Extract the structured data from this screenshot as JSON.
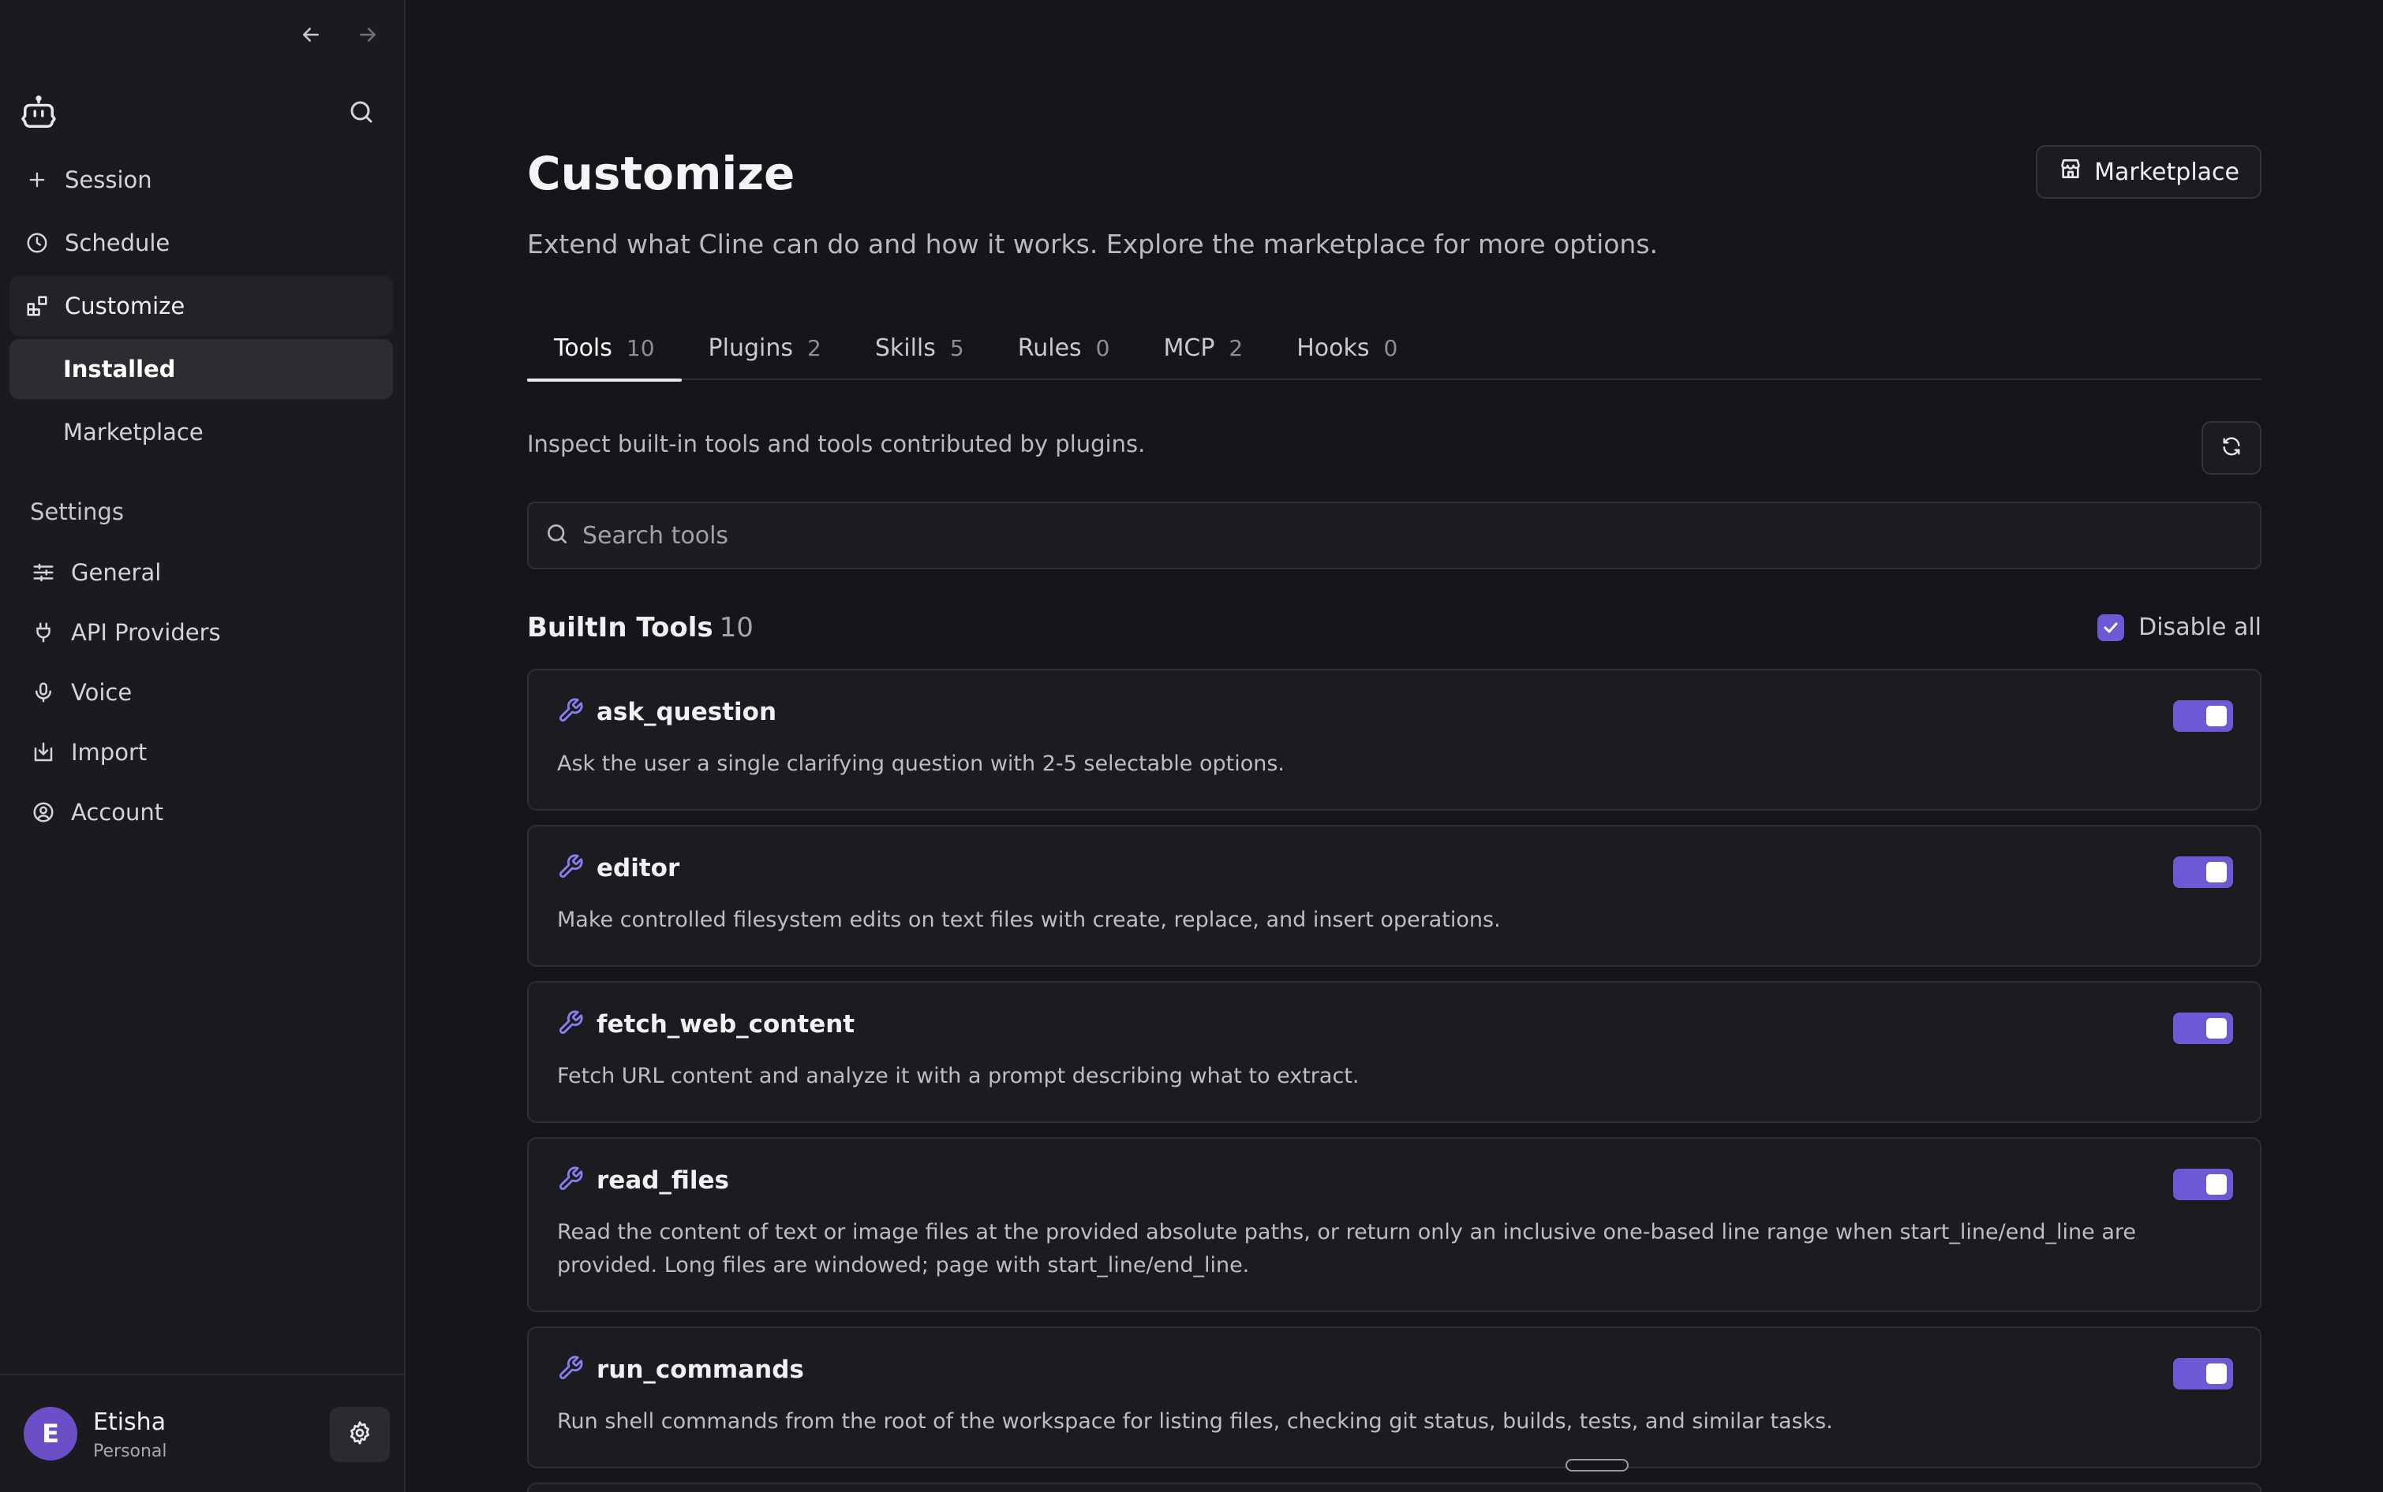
{
  "sidebar": {
    "nav": [
      {
        "label": "Session",
        "icon": "plus-icon"
      },
      {
        "label": "Schedule",
        "icon": "clock-icon"
      },
      {
        "label": "Customize",
        "icon": "customize-icon"
      }
    ],
    "sub": [
      {
        "label": "Installed"
      },
      {
        "label": "Marketplace"
      }
    ],
    "settings_label": "Settings",
    "settings": [
      {
        "label": "General",
        "icon": "sliders-icon"
      },
      {
        "label": "API Providers",
        "icon": "plug-icon"
      },
      {
        "label": "Voice",
        "icon": "microphone-icon"
      },
      {
        "label": "Import",
        "icon": "import-icon"
      },
      {
        "label": "Account",
        "icon": "user-circle-icon"
      }
    ],
    "user": {
      "initial": "E",
      "name": "Etisha",
      "plan": "Personal"
    }
  },
  "main": {
    "title": "Customize",
    "subtitle": "Extend what Cline can do and how it works. Explore the marketplace for more options.",
    "marketplace_button": "Marketplace",
    "tabs": [
      {
        "label": "Tools",
        "count": "10"
      },
      {
        "label": "Plugins",
        "count": "2"
      },
      {
        "label": "Skills",
        "count": "5"
      },
      {
        "label": "Rules",
        "count": "0"
      },
      {
        "label": "MCP",
        "count": "2"
      },
      {
        "label": "Hooks",
        "count": "0"
      }
    ],
    "inspect_text": "Inspect built-in tools and tools contributed by plugins.",
    "search_placeholder": "Search tools",
    "section": {
      "title": "BuiltIn Tools",
      "count": "10",
      "disable_all": "Disable all"
    },
    "tools": [
      {
        "name": "ask_question",
        "description": "Ask the user a single clarifying question with 2-5 selectable options.",
        "enabled": true
      },
      {
        "name": "editor",
        "description": "Make controlled filesystem edits on text files with create, replace, and insert operations.",
        "enabled": true
      },
      {
        "name": "fetch_web_content",
        "description": "Fetch URL content and analyze it with a prompt describing what to extract.",
        "enabled": true
      },
      {
        "name": "read_files",
        "description": "Read the content of text or image files at the provided absolute paths, or return only an inclusive one-based line range when start_line/end_line are provided. Long files are windowed; page with start_line/end_line.",
        "enabled": true
      },
      {
        "name": "run_commands",
        "description": "Run shell commands from the root of the workspace for listing files, checking git status, builds, tests, and similar tasks.",
        "enabled": true
      }
    ]
  },
  "colors": {
    "accent": "#6b5ad3",
    "background": "#15161b",
    "sidebar": "#1b1b1f"
  }
}
